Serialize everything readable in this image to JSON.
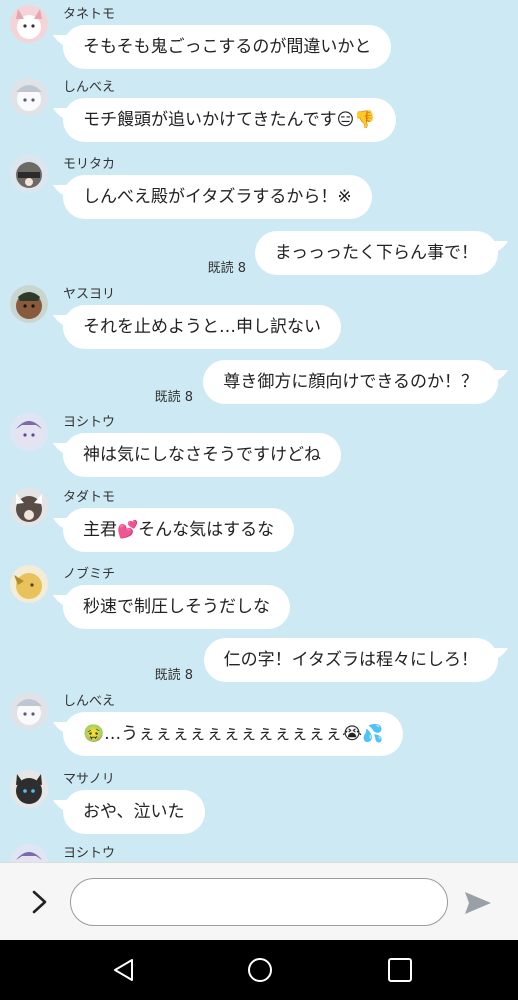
{
  "messages": [
    {
      "dir": "in",
      "sender": "タネトモ",
      "text": "そもそも鬼ごっこするのが間違いかと",
      "avatar": "wolf-pink-avatar"
    },
    {
      "dir": "in",
      "sender": "しんべえ",
      "text": "モチ饅頭が追いかけてきたんです",
      "emojis": "😑👎",
      "avatar": "white-cat-avatar"
    },
    {
      "dir": "in",
      "sender": "モリタカ",
      "text": "しんべえ殿がイタズラするから！※",
      "avatar": "raccoon-avatar"
    },
    {
      "dir": "out",
      "read": "既読 8",
      "text": "まっっったく下らん事で！"
    },
    {
      "dir": "in",
      "sender": "ヤスヨリ",
      "text": "それを止めようと…申し訳ない",
      "avatar": "boar-avatar"
    },
    {
      "dir": "out",
      "read": "既読 8",
      "text": "尊き御方に顔向けできるのか！？"
    },
    {
      "dir": "in",
      "sender": "ヨシトウ",
      "text": "神は気にしなさそうですけどね",
      "avatar": "purple-beast-avatar"
    },
    {
      "dir": "in",
      "sender": "タダトモ",
      "text_before": "主君",
      "emojis": "💕",
      "text": "そんな気はするな",
      "avatar": "wolf-scar-avatar"
    },
    {
      "dir": "in",
      "sender": "ノブミチ",
      "text": "秒速で制圧しそうだしな",
      "avatar": "yellow-dragon-avatar"
    },
    {
      "dir": "out",
      "read": "既読 8",
      "text": "仁の字！イタズラは程々にしろ！"
    },
    {
      "dir": "in",
      "sender": "しんべえ",
      "emojis_before": "🤢",
      "text": "…うぇぇぇぇぇぇぇぇぇぇぇぇ",
      "emojis": "😭💦",
      "avatar": "white-cat-avatar"
    },
    {
      "dir": "in",
      "sender": "マサノリ",
      "text": "おや、泣いた",
      "avatar": "black-wolf-avatar"
    },
    {
      "dir": "in",
      "sender": "ヨシトウ",
      "text": "",
      "avatar": "purple-beast-avatar"
    }
  ],
  "input": {
    "placeholder": "",
    "value": ""
  },
  "icons": {
    "expand": "chevron-right-icon",
    "send": "send-arrow-icon",
    "back": "nav-back-icon",
    "home": "nav-home-icon",
    "recents": "nav-recents-icon"
  },
  "colors": {
    "background": "#cde9f3",
    "bubble": "#ffffff",
    "navbar": "#000000"
  }
}
